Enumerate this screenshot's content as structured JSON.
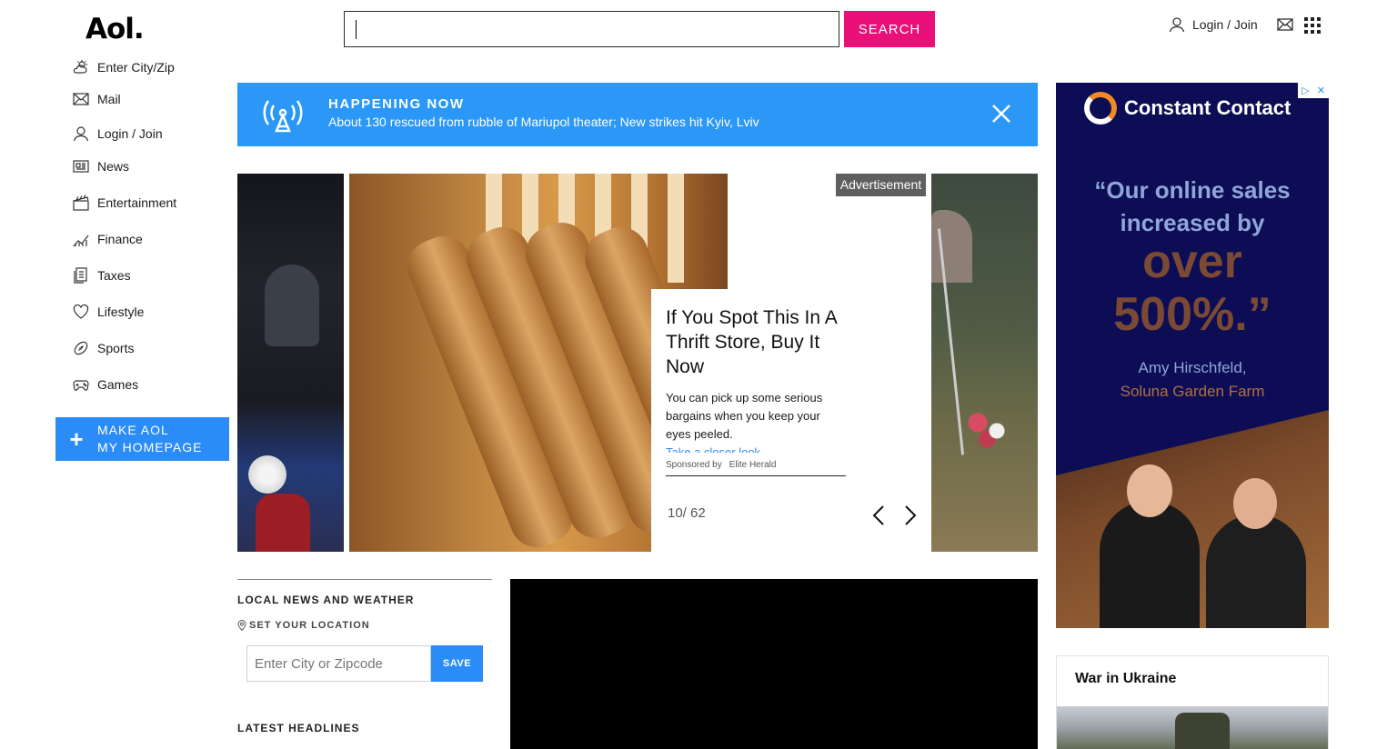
{
  "header": {
    "logo": "Aol.",
    "search_button": "SEARCH",
    "login": "Login / Join"
  },
  "sidebar": {
    "items": [
      {
        "label": "Enter City/Zip",
        "icon": "weather-icon"
      },
      {
        "label": "Mail",
        "icon": "mail-icon"
      },
      {
        "label": "Login / Join",
        "icon": "user-icon"
      },
      {
        "label": "News",
        "icon": "news-icon"
      },
      {
        "label": "Entertainment",
        "icon": "clapperboard-icon"
      },
      {
        "label": "Finance",
        "icon": "chart-icon"
      },
      {
        "label": "Taxes",
        "icon": "document-icon"
      },
      {
        "label": "Lifestyle",
        "icon": "heart-icon"
      },
      {
        "label": "Sports",
        "icon": "football-icon"
      },
      {
        "label": "Games",
        "icon": "gamepad-icon"
      }
    ],
    "make_homepage_line1": "MAKE AOL",
    "make_homepage_line2": "MY HOMEPAGE"
  },
  "banner": {
    "kicker": "HAPPENING NOW",
    "headline": "About 130 rescued from rubble of Mariupol theater; New strikes hit Kyiv, Lviv"
  },
  "carousel": {
    "ad_tag": "Advertisement",
    "title": "If You Spot This In A Thrift Store, Buy It Now",
    "description": "You can pick up some serious bargains when you keep your eyes peeled.",
    "more_link": "Take a closer look",
    "sponsored_by": "Sponsored by",
    "sponsor": "Elite Herald",
    "counter": "10/ 62"
  },
  "local": {
    "heading": "LOCAL NEWS AND WEATHER",
    "set_location": "SET YOUR LOCATION",
    "zip_placeholder": "Enter City or Zipcode",
    "save": "SAVE",
    "latest": "LATEST HEADLINES"
  },
  "ad": {
    "brand": "Constant Contact",
    "quote_line1": "“Our online sales",
    "quote_line2": "increased by",
    "quote_big1": "over",
    "quote_big2": "500%.”",
    "name": "Amy Hirschfeld,",
    "farm": "Soluna Garden Farm"
  },
  "war": {
    "heading": "War in Ukraine"
  },
  "colors": {
    "search_pink": "#ea0f79",
    "accent_blue": "#2b8cf7",
    "banner_blue": "#2b98f7",
    "ad_navy": "#0d0d55"
  }
}
